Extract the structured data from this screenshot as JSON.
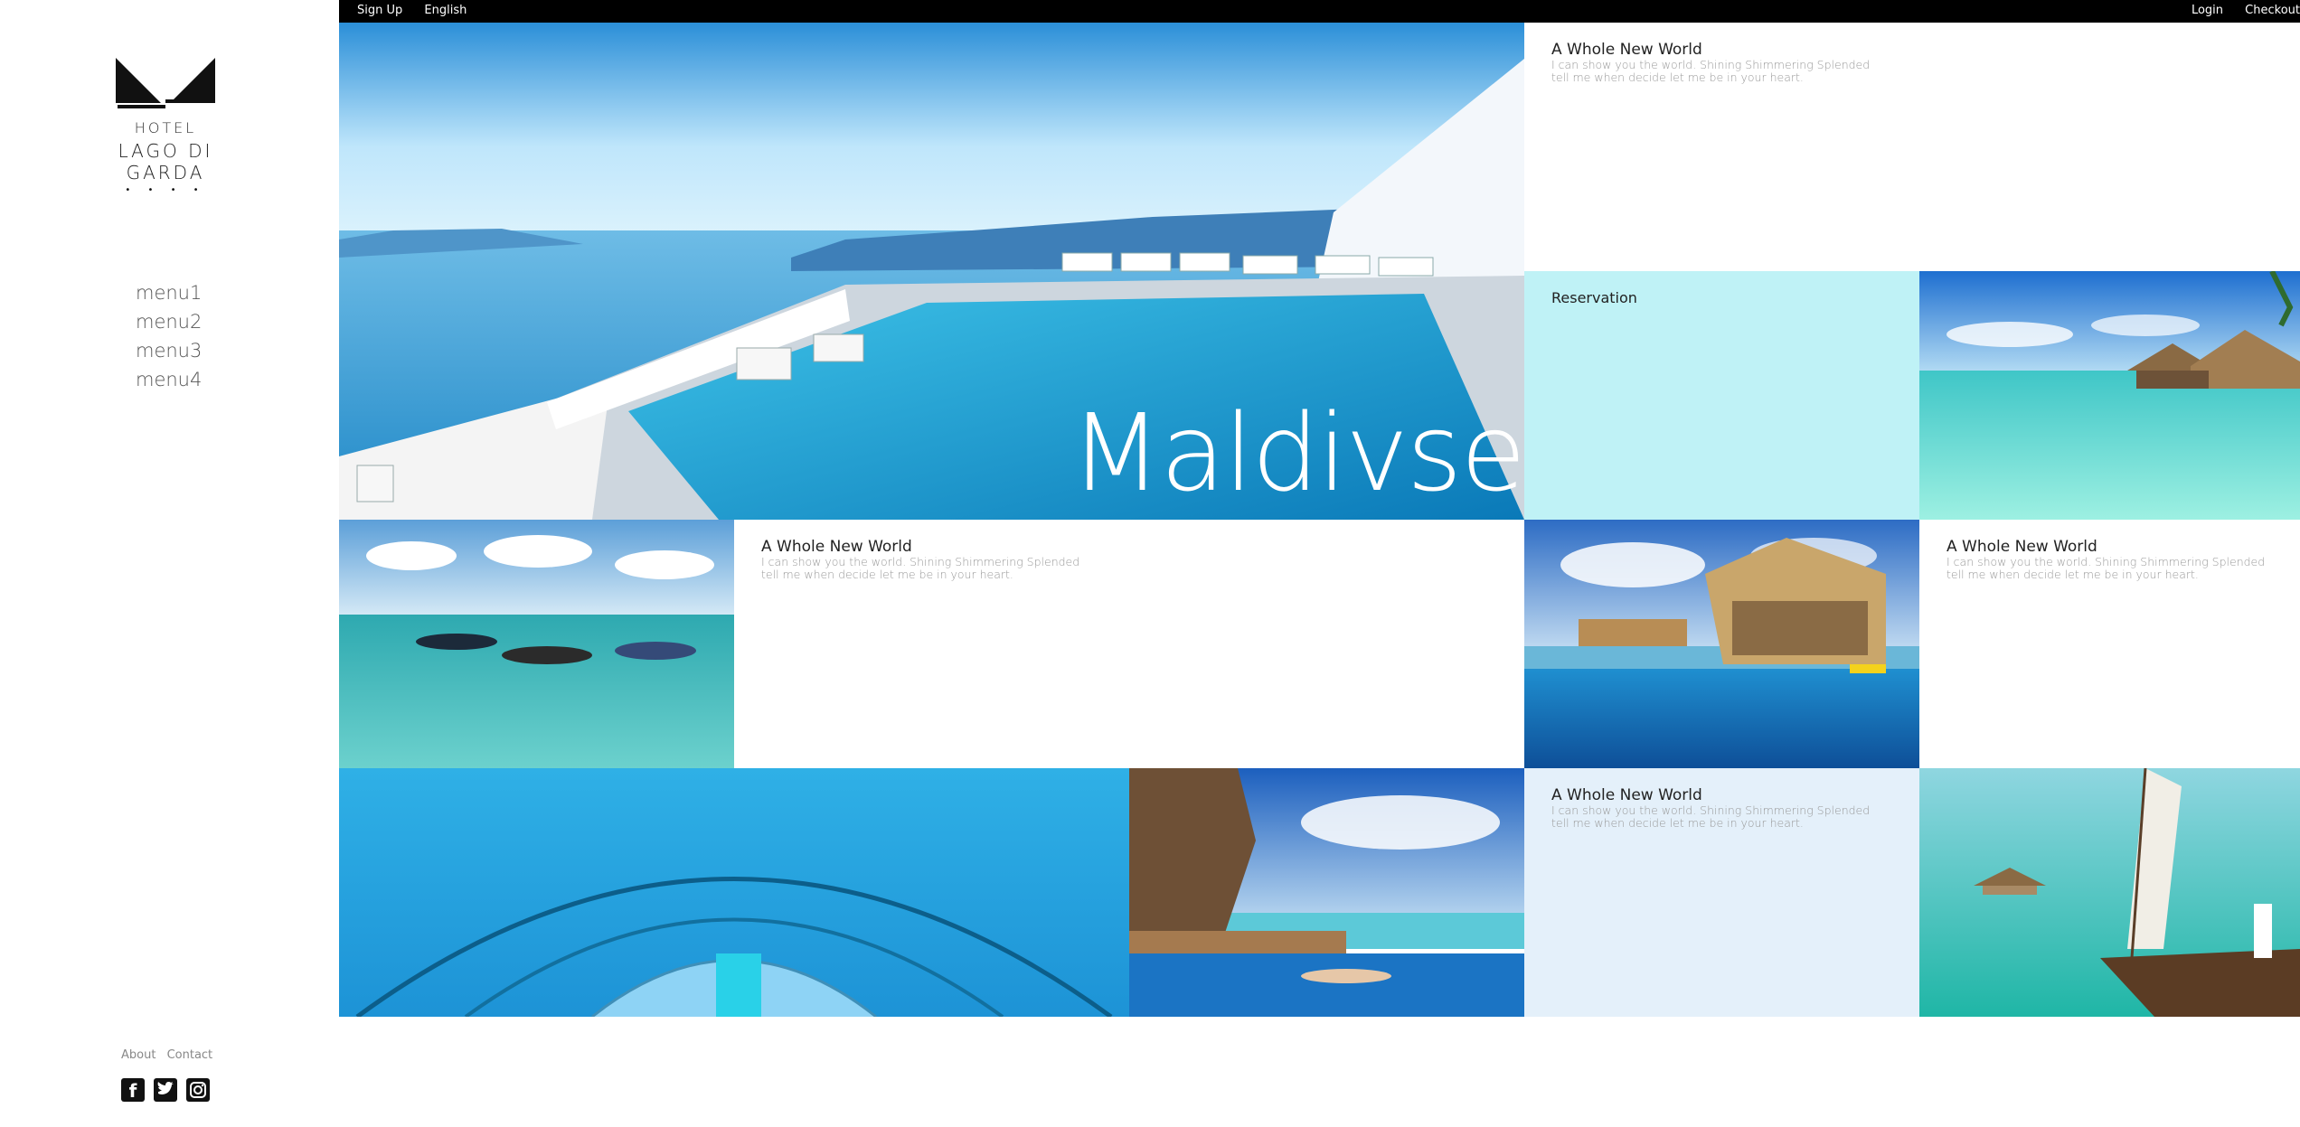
{
  "topbar": {
    "left": [
      "Sign Up",
      "English"
    ],
    "right": [
      "Login",
      "Checkout"
    ]
  },
  "logo": {
    "hotel": "HOTEL",
    "name": "LAGO DI GARDA",
    "stars": "• • • •"
  },
  "menu": [
    "menu1",
    "menu2",
    "menu3",
    "menu4"
  ],
  "footer": {
    "links": [
      "About",
      "Contact"
    ],
    "social": [
      "facebook-icon",
      "twitter-icon",
      "instagram-icon"
    ]
  },
  "hero": {
    "title": "Maldivse"
  },
  "cards": {
    "card1": {
      "title": "A Whole New World",
      "line1": "I can show you the world. Shining Shimmering Splended",
      "line2": "tell me when decide let me be in your heart."
    },
    "card2": {
      "title": "A Whole New World",
      "line1": "I can show you the world. Shining Shimmering Splended",
      "line2": "tell me when decide let me be in your heart."
    },
    "card3": {
      "title": "A Whole New World",
      "line1": "I can show you the world. Shining Shimmering Splended",
      "line2": "tell me when decide let me be in your heart."
    },
    "card4": {
      "title": "A Whole New World",
      "line1": "I can show you the world. Shining Shimmering Splended",
      "line2": "tell me when decide let me be in your heart."
    }
  },
  "reservation": {
    "label": "Reservation"
  },
  "colors": {
    "topbar": "#000000",
    "reservation": "#bff2f6",
    "light_card": "#e4f0fa"
  }
}
